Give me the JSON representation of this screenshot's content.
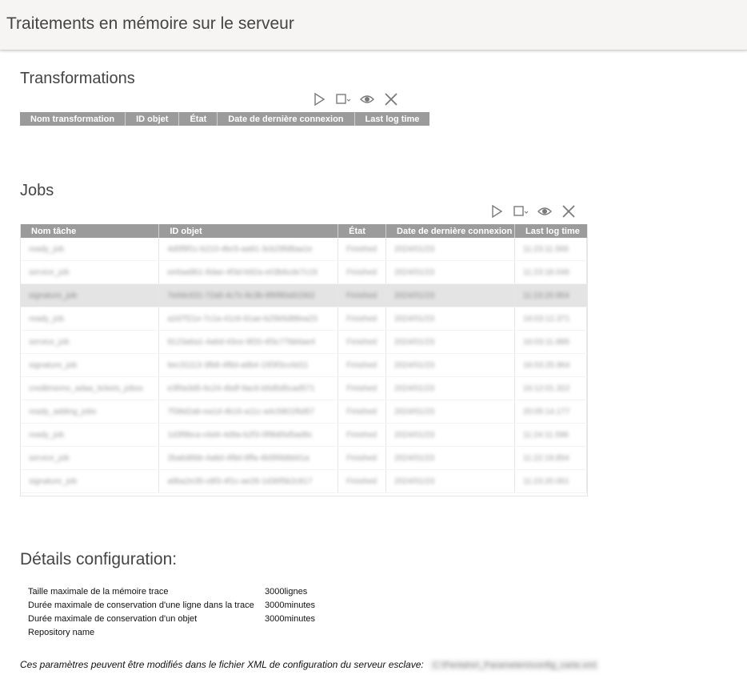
{
  "header": {
    "title": "Traitements en mémoire sur le serveur"
  },
  "toolbar": {
    "icons": [
      "play-icon",
      "stop-dropdown-icon",
      "eye-icon",
      "close-icon"
    ]
  },
  "transformations": {
    "title": "Transformations",
    "columns": [
      "Nom transformation",
      "ID objet",
      "État",
      "Date de dernière connexion",
      "Last log time"
    ],
    "rows": []
  },
  "jobs": {
    "title": "Jobs",
    "columns": [
      "Nom tâche",
      "ID objet",
      "État",
      "Date de dernière connexion",
      "Last log time"
    ],
    "rows": [
      [
        "ready_job",
        "4d0f9f1c-b210-4bc5-aa91-3cb29fd8aa1e",
        "Finished",
        "2024/01/23",
        "11:23:11.566"
      ],
      [
        "service_job",
        "ee6aa9b1-8dae-4f3d-b92a-e03b6cde7c19",
        "Finished",
        "2024/01/23",
        "11:23:18.049"
      ],
      [
        "signature_job",
        "7e0dc631-72a5-4c7c-8c3b-9f6f80a91563",
        "Finished",
        "2024/01/23",
        "11:23:20.954"
      ],
      [
        "ready_job",
        "a2d7f21e-7c1a-41c6-91ae-b25b5d88ea23",
        "Finished",
        "2024/01/23",
        "16:03:12.371"
      ],
      [
        "service_job",
        "9123a6a1-4a6d-43ce-9f20-4f3c77bb6ae4",
        "Finished",
        "2024/01/23",
        "16:03:11.889"
      ],
      [
        "signature_job",
        "6ec31113-3fb8-4f8d-a9b4-15f3f3cc6d11",
        "Finished",
        "2024/01/23",
        "16:03:25.964"
      ],
      [
        "creditmemo_adaa_tickets_jobss",
        "e3f0a3d5-6c24-4bdf-9ac6-b5d5d5cad571",
        "Finished",
        "2024/01/23",
        "16:12:01.322"
      ],
      [
        "ready_adding_jobs",
        "7f38d2ab-ea1d-4b16-a11c-a4c5801f6d57",
        "Finished",
        "2024/01/23",
        "20:05:14.177"
      ],
      [
        "ready_job",
        "1d3f9bca-c6d4-4d9a-b2f3-0f9b85d5ad9c",
        "Finished",
        "2024/01/23",
        "11:24:11.596"
      ],
      [
        "service_job",
        "2ba6d6bb-4a8d-4f8d-8ffa-4b5f6fd8d41a",
        "Finished",
        "2024/01/23",
        "11:22:19.854"
      ],
      [
        "signature_job",
        "a9ba2e35-c8f3-4f1c-ae28-1d36f5b2c817",
        "Finished",
        "2024/01/23",
        "11:23:20.061"
      ]
    ],
    "selected_row": 2
  },
  "config": {
    "title": "Détails configuration:",
    "items": [
      {
        "label": "Taille maximale de la mémoire trace",
        "value": "3000lignes"
      },
      {
        "label": "Durée maximale de conservation d'une ligne dans la trace",
        "value": "3000minutes"
      },
      {
        "label": "Durée maximale de conservation d'un objet",
        "value": "3000minutes"
      },
      {
        "label": "Repository name",
        "value": ""
      }
    ],
    "note": "Ces paramètres peuvent être modifiés dans le fichier XML de configuration du serveur esclave:",
    "note_path": "C:\\Pentaho\\_Parameters\\config_carte.xml"
  }
}
